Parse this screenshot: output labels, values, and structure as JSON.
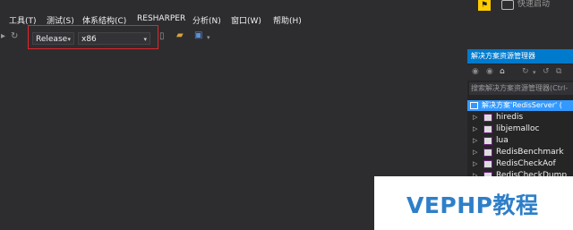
{
  "menu": {
    "items": [
      "工具(T)",
      "测试(S)",
      "体系结构(C)",
      "RESHARPER",
      "分析(N)",
      "窗口(W)",
      "帮助(H)"
    ]
  },
  "titlebar": {
    "quick_launch": "快速启动"
  },
  "toolbar": {
    "configuration": "Release",
    "platform": "x86"
  },
  "solution_explorer": {
    "title": "解决方案资源管理器",
    "search_placeholder": "搜索解决方案资源管理器(Ctrl-",
    "root": "解决方案'RedisServer' (",
    "projects": [
      "hiredis",
      "libjemalloc",
      "lua",
      "RedisBenchmark",
      "RedisCheckAof",
      "RedisCheckDump"
    ]
  },
  "watermark": {
    "text": "VEPHP教程"
  },
  "colors": {
    "background": "#2d2d30",
    "accent": "#007acc",
    "highlight_border": "#e0262a",
    "watermark_text": "#2e7fc9"
  }
}
